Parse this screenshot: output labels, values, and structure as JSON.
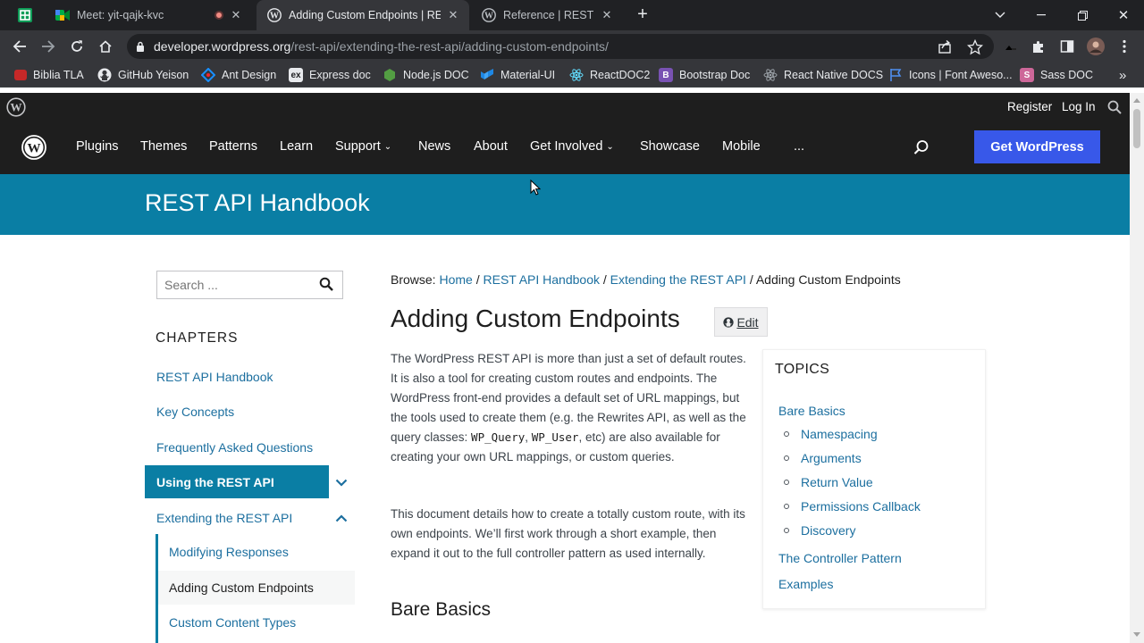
{
  "browser": {
    "tabs": [
      {
        "title": "Meet: yit-qajk-kvc",
        "active": false
      },
      {
        "title": "Adding Custom Endpoints | REST",
        "active": true
      },
      {
        "title": "Reference | REST API",
        "active": false
      }
    ],
    "url_host": "developer.wordpress.org",
    "url_path": "/rest-api/extending-the-rest-api/adding-custom-endpoints/",
    "bookmarks": [
      {
        "label": "Biblia  TLA",
        "icon": "bookmark-icon"
      },
      {
        "label": "GitHub Yeison",
        "icon": "github-icon"
      },
      {
        "label": "Ant Design",
        "icon": "ant-design-icon"
      },
      {
        "label": "Express doc",
        "icon": "express-icon"
      },
      {
        "label": "Node.js DOC",
        "icon": "nodejs-icon"
      },
      {
        "label": "Material-UI",
        "icon": "material-ui-icon"
      },
      {
        "label": "ReactDOC2",
        "icon": "react-icon"
      },
      {
        "label": "Bootstrap Doc",
        "icon": "bootstrap-icon"
      },
      {
        "label": "React Native DOCS",
        "icon": "react-icon"
      },
      {
        "label": "Icons | Font Aweso...",
        "icon": "font-awesome-icon"
      },
      {
        "label": "Sass DOC",
        "icon": "sass-icon"
      }
    ],
    "bookmarks_more": "»"
  },
  "wpbar": {
    "register": "Register",
    "login": "Log In"
  },
  "nav": {
    "items": [
      "Plugins",
      "Themes",
      "Patterns",
      "Learn",
      "Support",
      "News",
      "About",
      "Get Involved",
      "Showcase",
      "Mobile",
      "..."
    ],
    "get_wordpress": "Get WordPress"
  },
  "banner": {
    "title": "REST API Handbook"
  },
  "sidebar": {
    "search_placeholder": "Search ...",
    "chapters_heading": "CHAPTERS",
    "links": [
      "REST API Handbook",
      "Key Concepts",
      "Frequently Asked Questions"
    ],
    "active": "Using the REST API",
    "extending": "Extending the REST API",
    "sub": [
      "Modifying Responses",
      "Adding Custom Endpoints",
      "Custom Content Types"
    ]
  },
  "main": {
    "breadcrumb_prefix": "Browse:",
    "breadcrumb": [
      "Home",
      "REST API Handbook",
      "Extending the REST API"
    ],
    "breadcrumb_current": "Adding Custom Endpoints",
    "title": "Adding Custom Endpoints",
    "edit": "Edit",
    "para1_a": "The WordPress REST API is more than just a set of default routes. It is also a tool for creating custom routes and endpoints. The WordPress front-end provides a default set of URL mappings, but the tools used to create them (e.g. the Rewrites API, as well as the query classes: ",
    "para1_code1": "WP_Query",
    "para1_sep": ", ",
    "para1_code2": "WP_User",
    "para1_b": ", etc) are also available for creating your own URL mappings, or custom queries.",
    "para2": "This document details how to create a totally custom route, with its own endpoints. We’ll first work through a short example, then expand it out to the full controller pattern as used internally.",
    "h2": "Bare Basics"
  },
  "toc": {
    "heading": "TOPICS",
    "top": "Bare Basics",
    "children": [
      "Namespacing",
      "Arguments",
      "Return Value",
      "Permissions Callback",
      "Discovery"
    ],
    "after": [
      "The Controller Pattern",
      "Examples"
    ]
  },
  "colors": {
    "wp_blue": "#3858e9",
    "banner": "#0a7ea4",
    "link": "#1c6f9f",
    "dark": "#1e1e1e"
  }
}
